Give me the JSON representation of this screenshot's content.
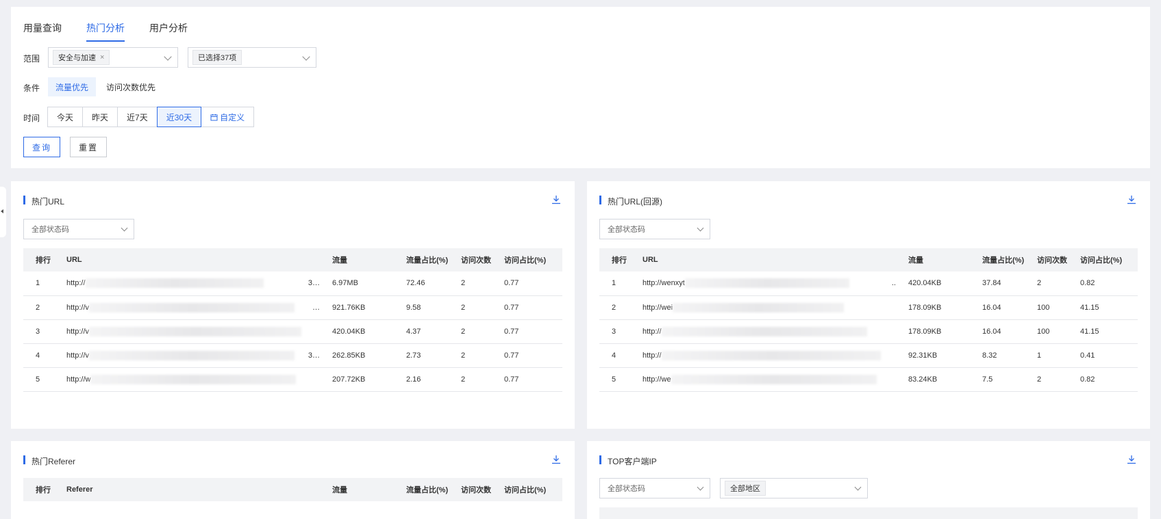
{
  "tabs": [
    {
      "label": "用量查询",
      "active": false
    },
    {
      "label": "热门分析",
      "active": true
    },
    {
      "label": "用户分析",
      "active": false
    }
  ],
  "filters": {
    "range_label": "范围",
    "range_chip": "安全与加速",
    "range_chip_close": "×",
    "range_selected": "已选择37项",
    "condition_label": "条件",
    "condition_options": [
      "流量优先",
      "访问次数优先"
    ],
    "time_label": "时间",
    "time_options": [
      "今天",
      "昨天",
      "近7天",
      "近30天"
    ],
    "time_custom": "自定义",
    "query_button": "查询",
    "reset_button": "重置"
  },
  "hot_url": {
    "title": "热门URL",
    "status_select": "全部状态码",
    "columns": [
      "排行",
      "URL",
      "流量",
      "流量占比(%)",
      "访问次数",
      "访问占比(%)"
    ],
    "rows": [
      {
        "rank": "1",
        "url": "http://",
        "url_tail": "3…",
        "traffic": "6.97MB",
        "traffic_pct": "72.46",
        "visits": "2",
        "visit_pct": "0.77"
      },
      {
        "rank": "2",
        "url": "http://v",
        "url_tail": "…",
        "traffic": "921.76KB",
        "traffic_pct": "9.58",
        "visits": "2",
        "visit_pct": "0.77"
      },
      {
        "rank": "3",
        "url": "http://v",
        "url_tail": "",
        "traffic": "420.04KB",
        "traffic_pct": "4.37",
        "visits": "2",
        "visit_pct": "0.77"
      },
      {
        "rank": "4",
        "url": "http://v",
        "url_tail": "3…",
        "traffic": "262.85KB",
        "traffic_pct": "2.73",
        "visits": "2",
        "visit_pct": "0.77"
      },
      {
        "rank": "5",
        "url": "http://w",
        "url_tail": "",
        "traffic": "207.72KB",
        "traffic_pct": "2.16",
        "visits": "2",
        "visit_pct": "0.77"
      }
    ]
  },
  "hot_url_origin": {
    "title": "热门URL(回源)",
    "status_select": "全部状态码",
    "columns": [
      "排行",
      "URL",
      "流量",
      "流量占比(%)",
      "访问次数",
      "访问占比(%)"
    ],
    "rows": [
      {
        "rank": "1",
        "url": "http://wenxyt",
        "url_tail": "..",
        "traffic": "420.04KB",
        "traffic_pct": "37.84",
        "visits": "2",
        "visit_pct": "0.82"
      },
      {
        "rank": "2",
        "url": "http://wei",
        "url_tail": "",
        "traffic": "178.09KB",
        "traffic_pct": "16.04",
        "visits": "100",
        "visit_pct": "41.15"
      },
      {
        "rank": "3",
        "url": "http://",
        "url_tail": "",
        "traffic": "178.09KB",
        "traffic_pct": "16.04",
        "visits": "100",
        "visit_pct": "41.15"
      },
      {
        "rank": "4",
        "url": "http://",
        "url_tail": "",
        "traffic": "92.31KB",
        "traffic_pct": "8.32",
        "visits": "1",
        "visit_pct": "0.41"
      },
      {
        "rank": "5",
        "url": "http://we",
        "url_tail": "",
        "traffic": "83.24KB",
        "traffic_pct": "7.5",
        "visits": "2",
        "visit_pct": "0.82"
      }
    ]
  },
  "hot_referer": {
    "title": "热门Referer",
    "columns": [
      "排行",
      "Referer",
      "流量",
      "流量占比(%)",
      "访问次数",
      "访问占比(%)"
    ]
  },
  "top_ip": {
    "title": "TOP客户端IP",
    "status_select": "全部状态码",
    "region_chip": "全部地区"
  },
  "colors": {
    "accent": "#2e6be6",
    "background": "#eff0f4"
  }
}
